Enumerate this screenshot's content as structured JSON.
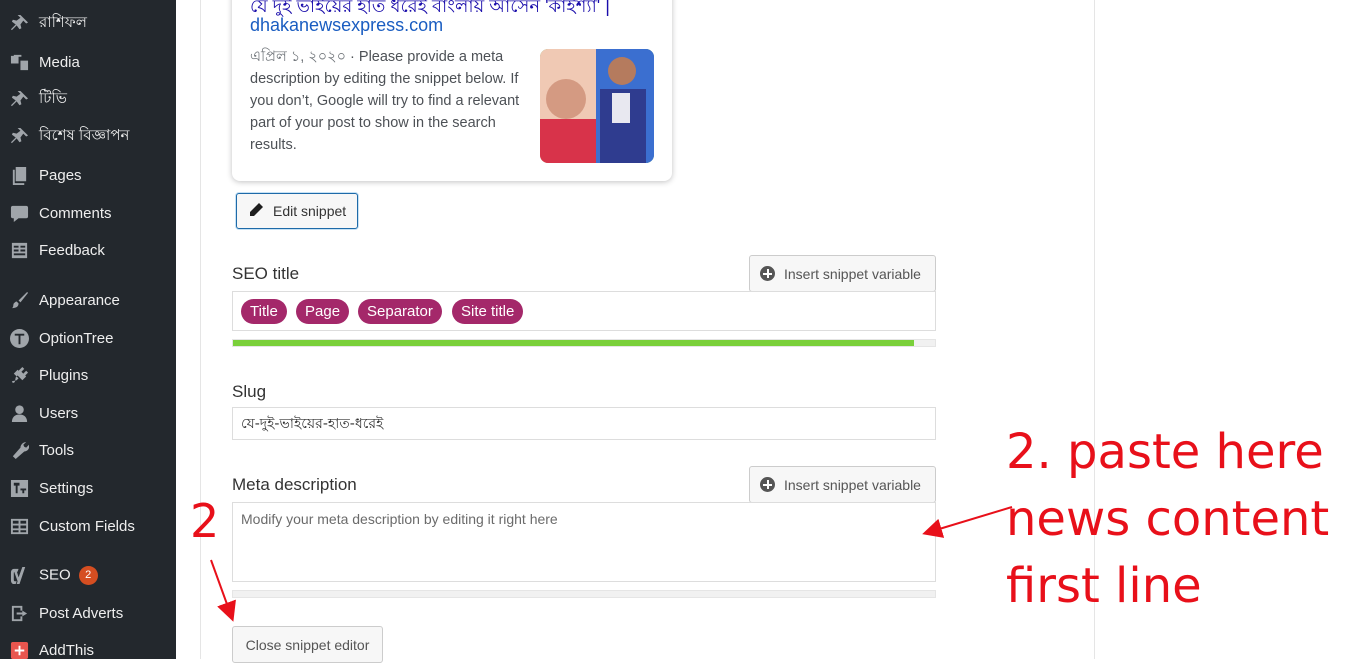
{
  "sidebar": {
    "items": [
      {
        "label": "রাশিফল",
        "icon": "pin-icon"
      },
      {
        "label": "Media",
        "icon": "media-icon"
      },
      {
        "label": "টিভি",
        "icon": "pin-icon"
      },
      {
        "label": "বিশেষ বিজ্ঞাপন",
        "icon": "pin-icon"
      },
      {
        "label": "Pages",
        "icon": "pages-icon"
      },
      {
        "label": "Comments",
        "icon": "comments-icon"
      },
      {
        "label": "Feedback",
        "icon": "feedback-icon"
      },
      {
        "label": "Appearance",
        "icon": "brush-icon"
      },
      {
        "label": "OptionTree",
        "icon": "optiontree-icon"
      },
      {
        "label": "Plugins",
        "icon": "plugin-icon"
      },
      {
        "label": "Users",
        "icon": "user-icon"
      },
      {
        "label": "Tools",
        "icon": "wrench-icon"
      },
      {
        "label": "Settings",
        "icon": "settings-icon"
      },
      {
        "label": "Custom Fields",
        "icon": "table-icon"
      },
      {
        "label": "SEO",
        "icon": "yoast-icon",
        "badge": "2"
      },
      {
        "label": "Post Adverts",
        "icon": "exit-icon"
      },
      {
        "label": "AddThis",
        "icon": "plus-red-icon"
      }
    ]
  },
  "preview": {
    "title": "যে দুই ভাইয়ের হাত ধরেই বাংলায় আসেন 'কাইশ্যা' |",
    "url": "dhakanewsexpress.com",
    "date": "এপ্রিল ১, ২০২০",
    "separator": " · ",
    "description": "Please provide a meta description by editing the snippet below. If you don’t, Google will try to find a relevant part of your post to show in the search results."
  },
  "buttons": {
    "edit_snippet": "Edit snippet",
    "insert_variable": "Insert snippet variable",
    "close_editor": "Close snippet editor"
  },
  "seo_title": {
    "label": "SEO title",
    "pills": [
      "Title",
      "Page",
      "Separator",
      "Site title"
    ],
    "progress": 0.97
  },
  "slug": {
    "label": "Slug",
    "value": "যে-দুই-ভাইয়ের-হাত-ধরেই"
  },
  "meta_description": {
    "label": "Meta description",
    "placeholder": "Modify your meta description by editing it right here",
    "progress": 0
  },
  "annotations": {
    "number": "2",
    "lines": [
      "2. paste here",
      "news content",
      "first line"
    ],
    "color": "#e8101a"
  },
  "colors": {
    "sidebar_bg": "#23282d",
    "pill": "#a4286a",
    "progress_good": "#7ad03a",
    "badge": "#d54e21"
  }
}
